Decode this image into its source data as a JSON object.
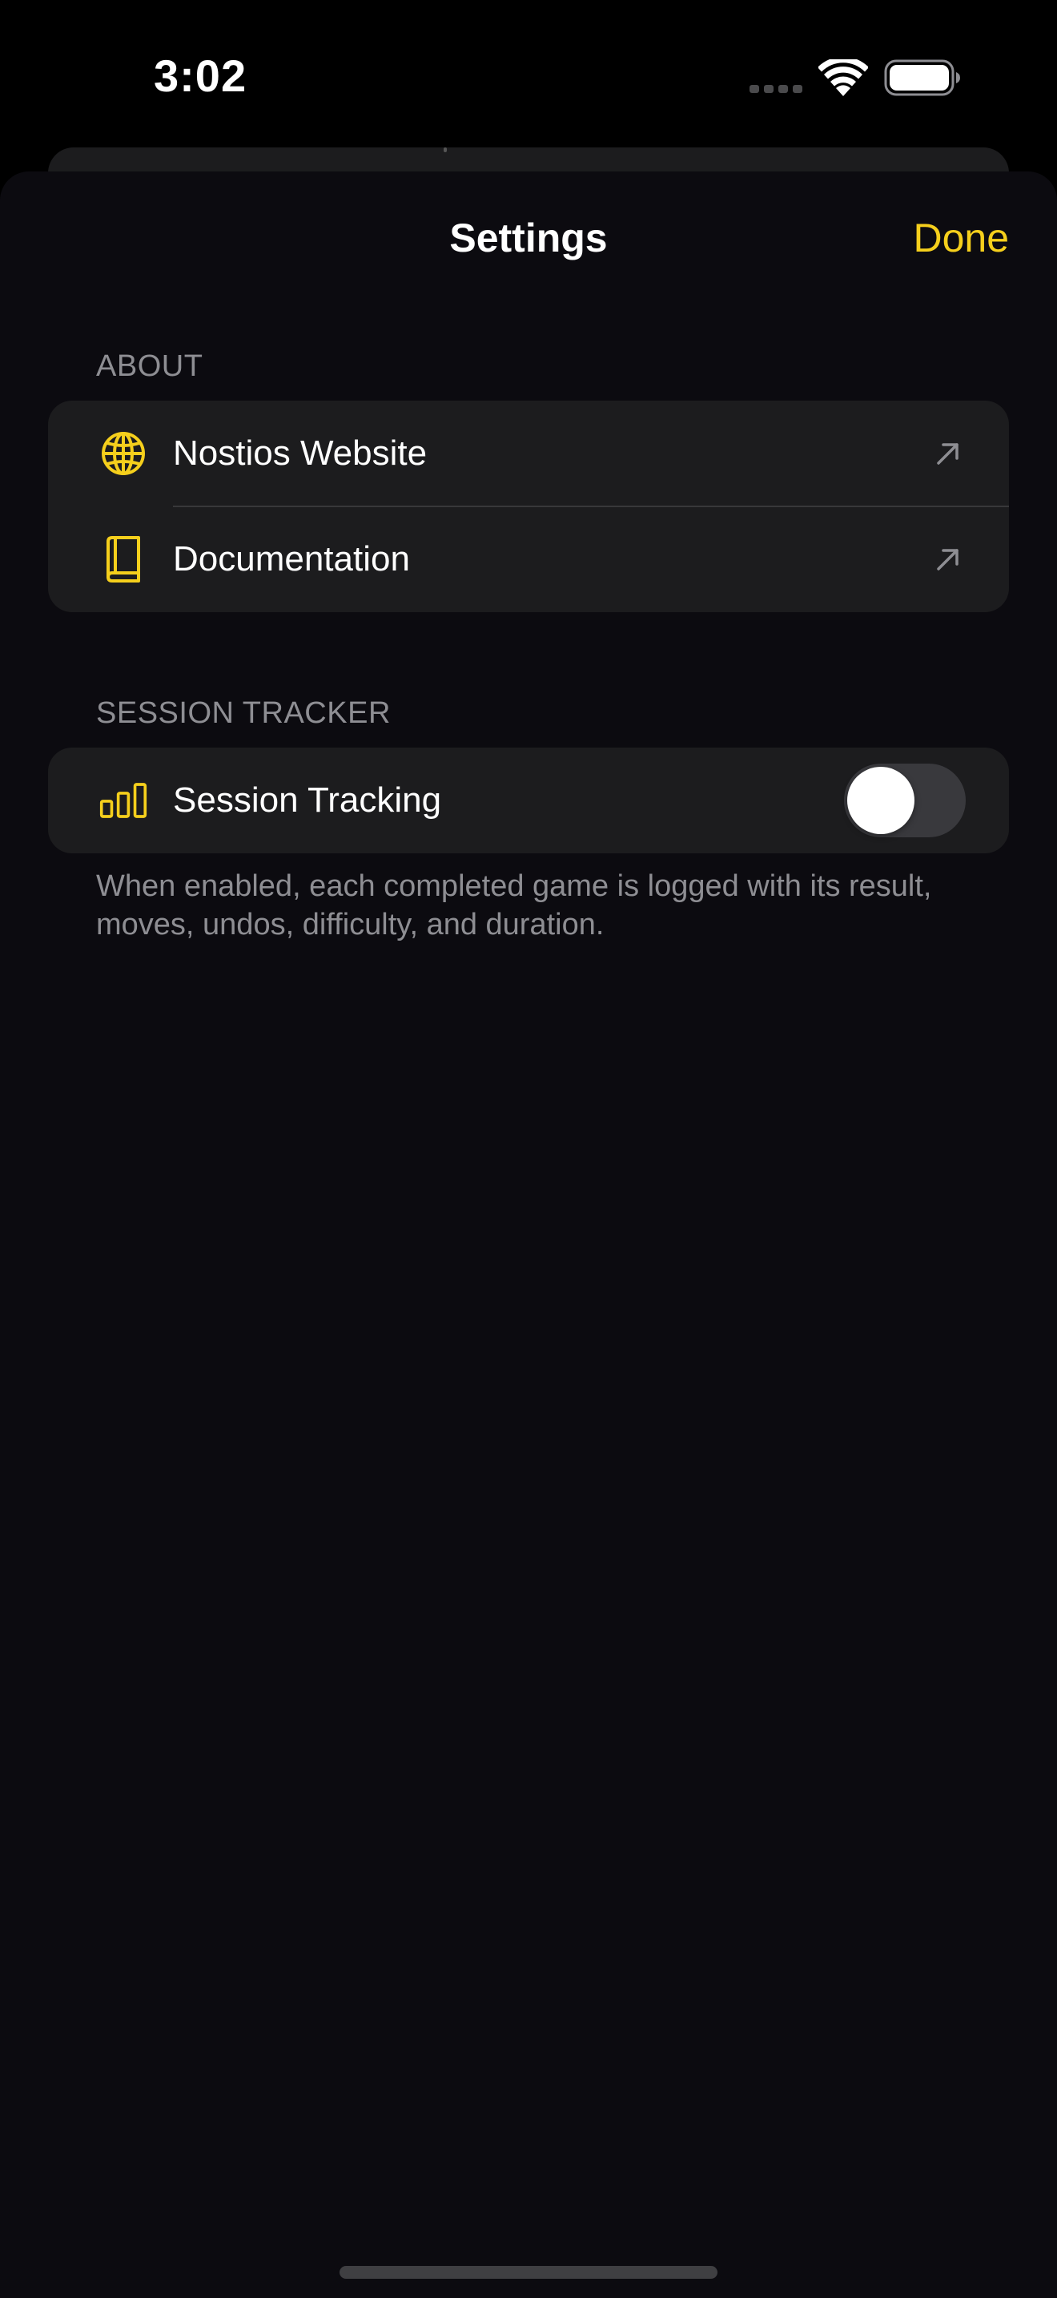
{
  "status_bar": {
    "time": "3:02"
  },
  "sheet": {
    "title": "Settings",
    "done_label": "Done"
  },
  "about": {
    "header": "ABOUT",
    "items": [
      {
        "label": "Nostios Website",
        "icon": "globe-icon"
      },
      {
        "label": "Documentation",
        "icon": "book-icon"
      }
    ]
  },
  "session_tracker": {
    "header": "SESSION TRACKER",
    "item": {
      "label": "Session Tracking",
      "icon": "chart-bars-icon",
      "enabled": false
    },
    "footer": "When enabled, each completed game is logged with its result, moves, undos, difficulty, and duration."
  },
  "colors": {
    "accent": "#f5cf1c",
    "background": "#0c0b10",
    "group_background": "#1c1c1e",
    "secondary_text": "#8e8e93"
  }
}
